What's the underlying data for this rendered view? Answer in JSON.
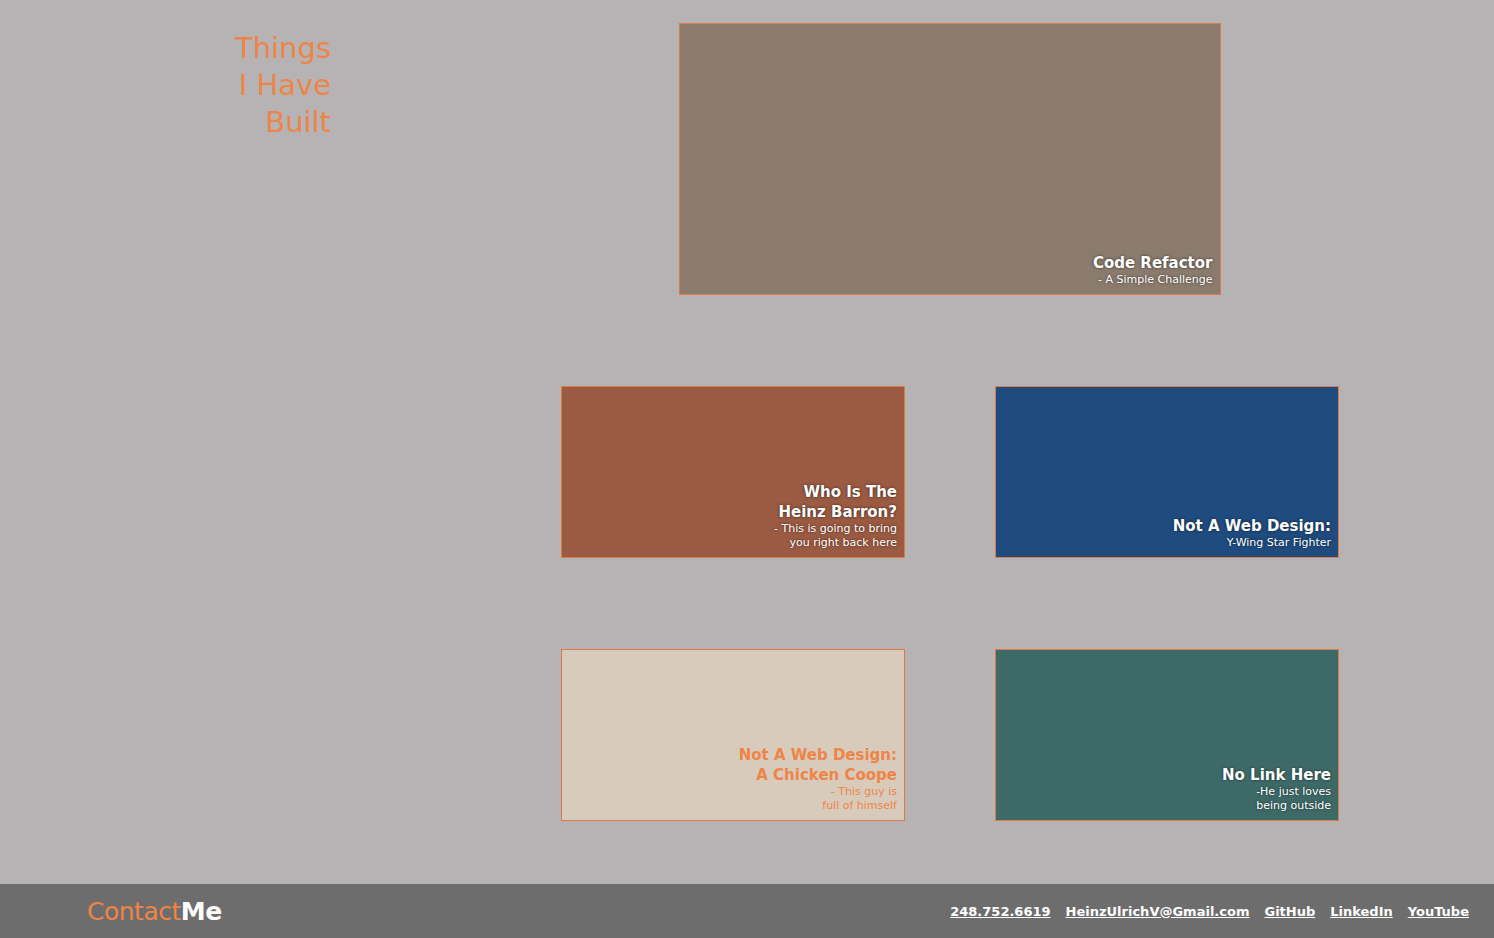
{
  "heading": [
    "Things",
    "I Have",
    "Built"
  ],
  "featured": {
    "title": [
      "Code Refactor"
    ],
    "subtitle": [
      "- A Simple Challenge"
    ],
    "color": "#8a7b6d",
    "kind": "light"
  },
  "projects": [
    {
      "title": [
        "Who Is The",
        "Heinz Barron?"
      ],
      "subtitle": [
        "- This is going to bring",
        "you right back here"
      ],
      "color": "#9b5a42",
      "kind": "light"
    },
    {
      "title": [
        "Not A Web Design:"
      ],
      "subtitle": [
        "Y-Wing Star Fighter"
      ],
      "color": "#1f4b7f",
      "kind": "light"
    },
    {
      "title": [
        "Not A Web Design:",
        "A Chicken Coope"
      ],
      "subtitle": [
        "- This guy is",
        "full of himself"
      ],
      "color": "#d8cbbb",
      "kind": "accent"
    },
    {
      "title": [
        "No Link Here"
      ],
      "subtitle": [
        "-He just loves",
        "being outside"
      ],
      "color": "#3d6a67",
      "kind": "light"
    }
  ],
  "footer": {
    "logo": {
      "accent": "Contact",
      "rest": "Me"
    },
    "links": [
      "248.752.6619",
      "HeinzUlrichV@Gmail.com",
      "GitHub",
      "LinkedIn",
      "YouTube"
    ]
  }
}
